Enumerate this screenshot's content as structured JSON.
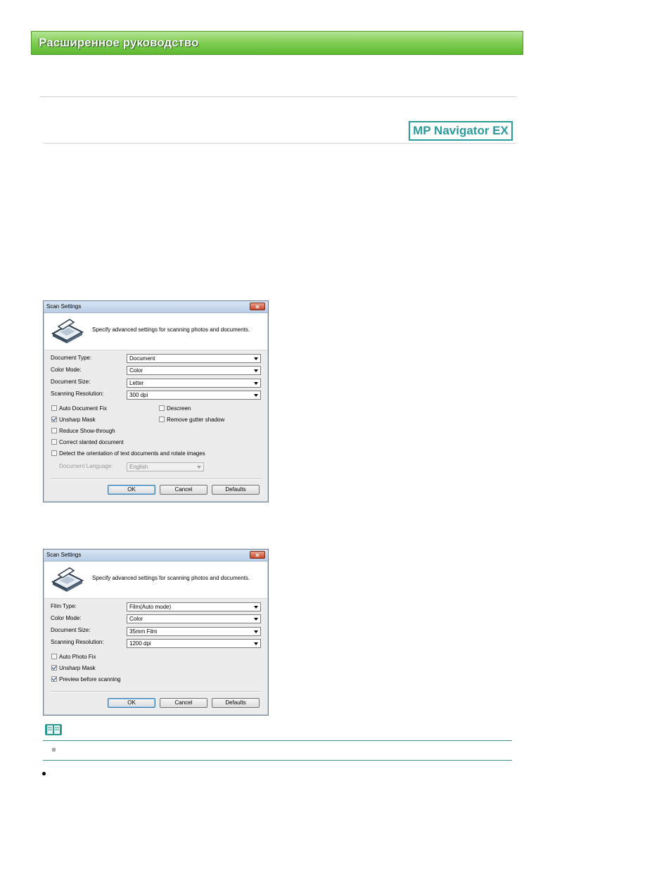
{
  "banner": {
    "title": "Расширенное руководство"
  },
  "logo": {
    "text": "MP Navigator EX"
  },
  "dialog1": {
    "title": "Scan Settings",
    "close": "✕",
    "description": "Specify advanced settings for scanning photos and documents.",
    "fields": [
      {
        "label": "Document Type:",
        "value": "Document"
      },
      {
        "label": "Color Mode:",
        "value": "Color"
      },
      {
        "label": "Document Size:",
        "value": "Letter"
      },
      {
        "label": "Scanning Resolution:",
        "value": "300 dpi"
      }
    ],
    "checkboxes": [
      {
        "label": "Auto Document Fix",
        "checked": false
      },
      {
        "label": "Descreen",
        "checked": false
      },
      {
        "label": "Unsharp Mask",
        "checked": true
      },
      {
        "label": "Remove gutter shadow",
        "checked": false
      },
      {
        "label": "Reduce Show-through",
        "checked": false
      },
      {
        "label": "Correct slanted document",
        "checked": false
      },
      {
        "label": "Detect the orientation of text documents and rotate images",
        "checked": false
      }
    ],
    "language": {
      "label": "Document Language:",
      "value": "English"
    },
    "buttons": {
      "ok": "OK",
      "cancel": "Cancel",
      "defaults": "Defaults"
    }
  },
  "dialog2": {
    "title": "Scan Settings",
    "close": "✕",
    "description": "Specify advanced settings for scanning photos and documents.",
    "fields": [
      {
        "label": "Film Type:",
        "value": "Film(Auto mode)"
      },
      {
        "label": "Color Mode:",
        "value": "Color"
      },
      {
        "label": "Document Size:",
        "value": "35mm Film"
      },
      {
        "label": "Scanning Resolution:",
        "value": "1200 dpi"
      }
    ],
    "checkboxes": [
      {
        "label": "Auto Photo Fix",
        "checked": false
      },
      {
        "label": "Unsharp Mask",
        "checked": true
      },
      {
        "label": "Preview before scanning",
        "checked": true
      }
    ],
    "buttons": {
      "ok": "OK",
      "cancel": "Cancel",
      "defaults": "Defaults"
    }
  },
  "colors": {
    "banner": "#6cc23e",
    "logo": "#2a9b9a",
    "note_rule": "#3b8f8a"
  },
  "icons": {
    "scanner": "scanner-icon",
    "note": "note-book-icon"
  }
}
